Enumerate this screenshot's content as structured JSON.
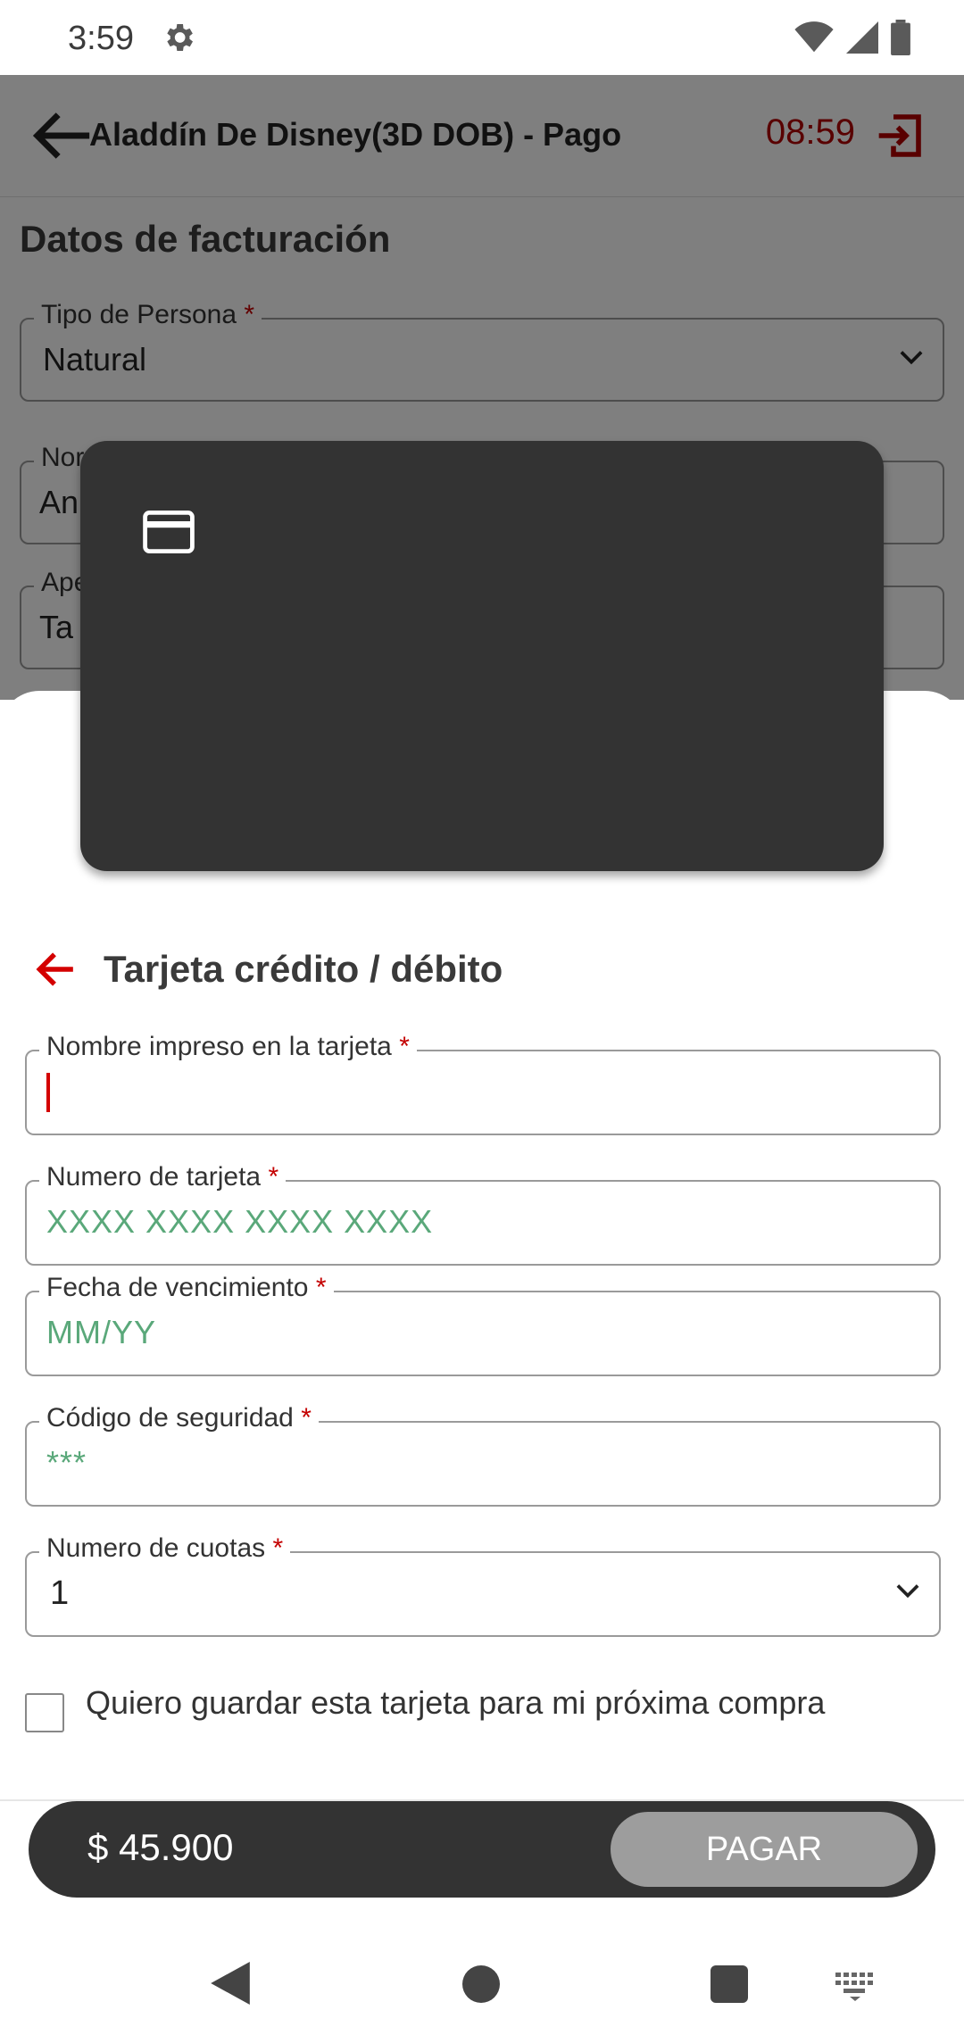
{
  "status_bar": {
    "time": "3:59"
  },
  "header": {
    "title": "Aladdín De Disney(3D DOB) - Pago",
    "timer": "08:59"
  },
  "billing": {
    "section_title": "Datos de facturación",
    "person_type": {
      "label": "Tipo de Persona",
      "value": "Natural"
    },
    "name_field": {
      "label_partial": "Nor",
      "value_partial": "An"
    },
    "lastname_field": {
      "label_partial": "Ape",
      "value_partial": "Ta"
    }
  },
  "card_form": {
    "title": "Tarjeta crédito / débito",
    "fields": {
      "name_on_card": {
        "label": "Nombre impreso en la tarjeta",
        "value": ""
      },
      "card_number": {
        "label": "Numero de tarjeta",
        "placeholder": "XXXX XXXX XXXX XXXX"
      },
      "expiry": {
        "label": "Fecha de vencimiento",
        "placeholder": "MM/YY"
      },
      "cvv": {
        "label": "Código de seguridad",
        "placeholder": "***"
      },
      "installments": {
        "label": "Numero de cuotas",
        "value": "1"
      }
    },
    "required_mark": "*",
    "save_card_label": "Quiero guardar esta tarjeta para mi próxima compra"
  },
  "pay_bar": {
    "amount": "$ 45.900",
    "pay_label": "PAGAR"
  },
  "colors": {
    "accent": "#c40000",
    "dark": "#333333",
    "placeholder": "#5aa87a",
    "button_disabled": "#9d9d9d"
  }
}
